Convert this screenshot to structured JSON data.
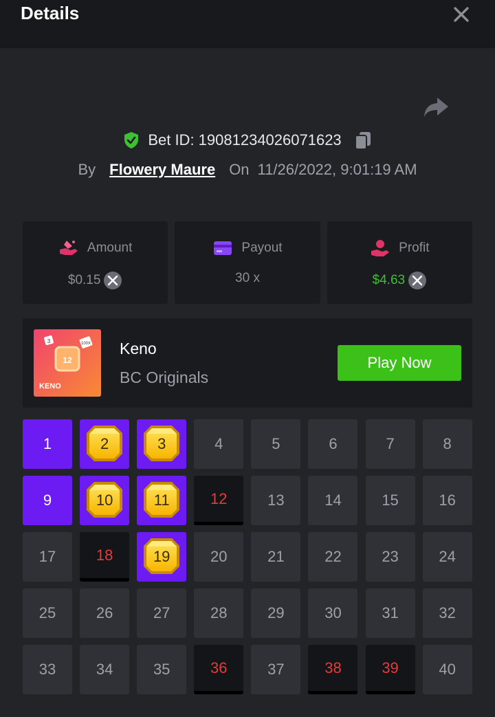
{
  "header": {
    "title": "Details"
  },
  "bet": {
    "id_label": "Bet ID: 19081234026071623",
    "by_label": "By",
    "user": "Flowery Maure",
    "on_label": "On",
    "date": "11/26/2022, 9:01:19 AM"
  },
  "stats": [
    {
      "label": "Amount",
      "value": "$0.15",
      "icon": "amount-hand-icon",
      "currency_icon": "xrp-coin-icon"
    },
    {
      "label": "Payout",
      "value": "30 x",
      "icon": "card-icon"
    },
    {
      "label": "Profit",
      "value": "$4.63",
      "icon": "profit-hand-icon",
      "currency_icon": "xrp-coin-icon",
      "value_color": "#3fc034"
    }
  ],
  "game": {
    "name": "Keno",
    "provider": "BC Originals",
    "play_label": "Play Now",
    "thumb_text": "KENO",
    "thumb_number": "12",
    "thumb_die": "3",
    "thumb_tag": "100X"
  },
  "grid": {
    "cells": [
      "1",
      "2",
      "3",
      "4",
      "5",
      "6",
      "7",
      "8",
      "9",
      "10",
      "11",
      "12",
      "13",
      "14",
      "15",
      "16",
      "17",
      "18",
      "19",
      "20",
      "21",
      "22",
      "23",
      "24",
      "25",
      "26",
      "27",
      "28",
      "29",
      "30",
      "31",
      "32",
      "33",
      "34",
      "35",
      "36",
      "37",
      "38",
      "39",
      "40"
    ],
    "picked": [
      1,
      9
    ],
    "matched": [
      2,
      3,
      10,
      11,
      19
    ],
    "drawn_missed": [
      12,
      18,
      36,
      38,
      39
    ]
  },
  "colors": {
    "picked": "#6c1cf3",
    "drawn": "#e23c3c",
    "play": "#3bc117",
    "profit": "#3fc034"
  }
}
